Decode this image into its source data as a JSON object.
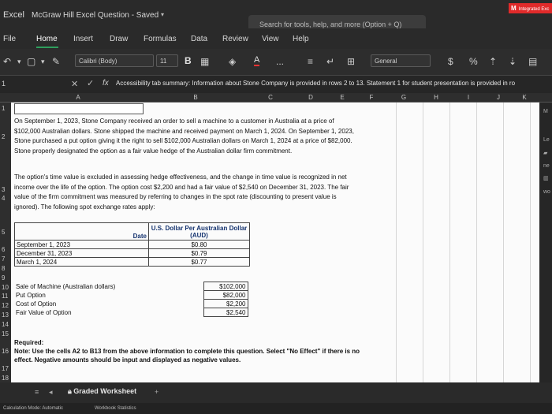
{
  "window": {
    "app_name": "Excel",
    "doc_title": "McGraw Hill Excel Question - Saved",
    "search_placeholder": "Search for tools, help, and more (Option + Q)",
    "brand_letter": "M",
    "brand_text": "Integrated Exc"
  },
  "ribbon": {
    "tabs": [
      "File",
      "Home",
      "Insert",
      "Draw",
      "Formulas",
      "Data",
      "Review",
      "View",
      "Help"
    ],
    "active_tab": "Home"
  },
  "toolbar": {
    "font_name": "Calibri (Body)",
    "font_size": "11",
    "bold_label": "B",
    "font_color_label": "A",
    "more_label": "...",
    "number_format": "General",
    "currency_label": "$"
  },
  "formula_bar": {
    "name_box": "1",
    "fx_label": "fx",
    "formula_text": "Accessibility tab summary: Information about Stone Company is provided in rows 2 to 13. Statement 1 for student presentation is provided in ro"
  },
  "grid": {
    "columns": [
      "A",
      "B",
      "C",
      "D",
      "E",
      "F",
      "G",
      "H",
      "I",
      "J",
      "K"
    ],
    "row_numbers": [
      "1",
      "2",
      "3",
      "4",
      "5",
      "6",
      "7",
      "8",
      "9",
      "10",
      "11",
      "12",
      "13",
      "14",
      "15",
      "16",
      "17",
      "18"
    ],
    "right_panel": [
      "M",
      "Le",
      "ne",
      "wo"
    ]
  },
  "sheet": {
    "paragraph_1": "On September 1, 2023, Stone Company received an order to sell a machine to a customer in Australia at a price of $102,000 Australian dollars. Stone shipped the machine and received payment on March 1, 2024. On September 1, 2023, Stone purchased a put option giving it the right to sell $102,000 Australian dollars on March 1, 2024 at a price of $82,000. Stone properly designated the option as a fair value hedge of the Australian dollar firm commitment.",
    "paragraph_2": "The option's time value is excluded in assessing hedge effectiveness, and the change in time value is recognized in net income over the life of the option. The option cost $2,200 and had a fair value of $2,540 on December 31, 2023. The fair value of the firm commitment was measured by referring to changes in the spot rate (discounting to present value is ignored). The following spot exchange rates apply:",
    "rates_header_date": "Date",
    "rates_header_rate": "U.S. Dollar Per Australian Dollar (AUD)",
    "rates": [
      {
        "date": "September 1, 2023",
        "rate": "$0.80"
      },
      {
        "date": "December 31, 2023",
        "rate": "$0.79"
      },
      {
        "date": "March 1, 2024",
        "rate": "$0.77"
      }
    ],
    "items": [
      {
        "label": "Sale of Machine (Australian dollars)",
        "value": "$102,000"
      },
      {
        "label": "Put Option",
        "value": "$82,000"
      },
      {
        "label": "Cost of Option",
        "value": "$2,200"
      },
      {
        "label": "Fair Value of Option",
        "value": "$2,540"
      }
    ],
    "required_title": "Required:",
    "required_note": "Note: Use the cells A2 to B13 from the above information to complete this question. Select \"No Effect\" if there is no effect. Negative amounts should be input and displayed as negative values."
  },
  "sheet_tabs": {
    "active": "Graded Worksheet",
    "add_label": "+"
  },
  "status": {
    "calc_mode": "Calculation Mode: Automatic",
    "stats": "Workbook Statistics"
  }
}
